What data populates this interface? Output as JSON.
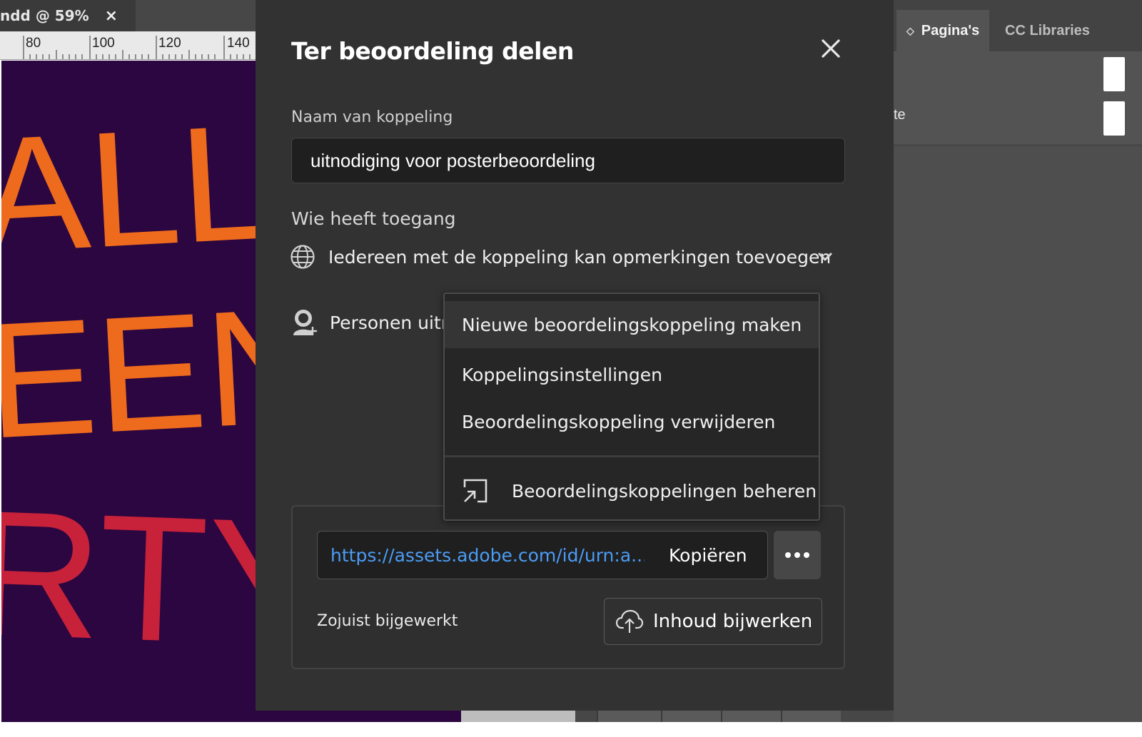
{
  "background": {
    "doc_tab": {
      "label": "ndd @ 59%",
      "close_glyph": "×"
    },
    "ruler": {
      "marks": [
        "80",
        "100",
        "120",
        "140"
      ]
    },
    "canvas_letters": {
      "line1": "ALLO",
      "line2": "EEN",
      "line3": "RTY",
      "colors": {
        "orange": "#ee6a1c",
        "red": "#c8213a",
        "bg": "#2b0640"
      }
    },
    "right_panel": {
      "tabs": [
        {
          "label": "Pagina's"
        },
        {
          "label": "CC Libraries"
        }
      ],
      "partial_text": "te"
    }
  },
  "dialog": {
    "title": "Ter beoordeling delen",
    "name_label": "Naam van koppeling",
    "name_value": "uitnodiging voor posterbeoordeling",
    "access_label": "Wie heeft toegang",
    "access_value": "Iedereen met de koppeling kan opmerkingen toevoegen",
    "invite_label": "Personen uitnodigen",
    "url": "https://assets.adobe.com/id/urn:a...",
    "copy_label": "Kopiëren",
    "updated_text": "Zojuist bijgewerkt",
    "update_label": "Inhoud bijwerken",
    "colors": {
      "dialog_bg": "#323232",
      "link": "#4b9cf5"
    }
  },
  "menu": {
    "items": [
      {
        "label": "Nieuwe beoordelingskoppeling maken"
      },
      {
        "label": "Koppelingsinstellingen"
      },
      {
        "label": "Beoordelingskoppeling verwijderen"
      },
      {
        "label": "Beoordelingskoppelingen beheren",
        "icon": "open-external-icon"
      }
    ]
  }
}
